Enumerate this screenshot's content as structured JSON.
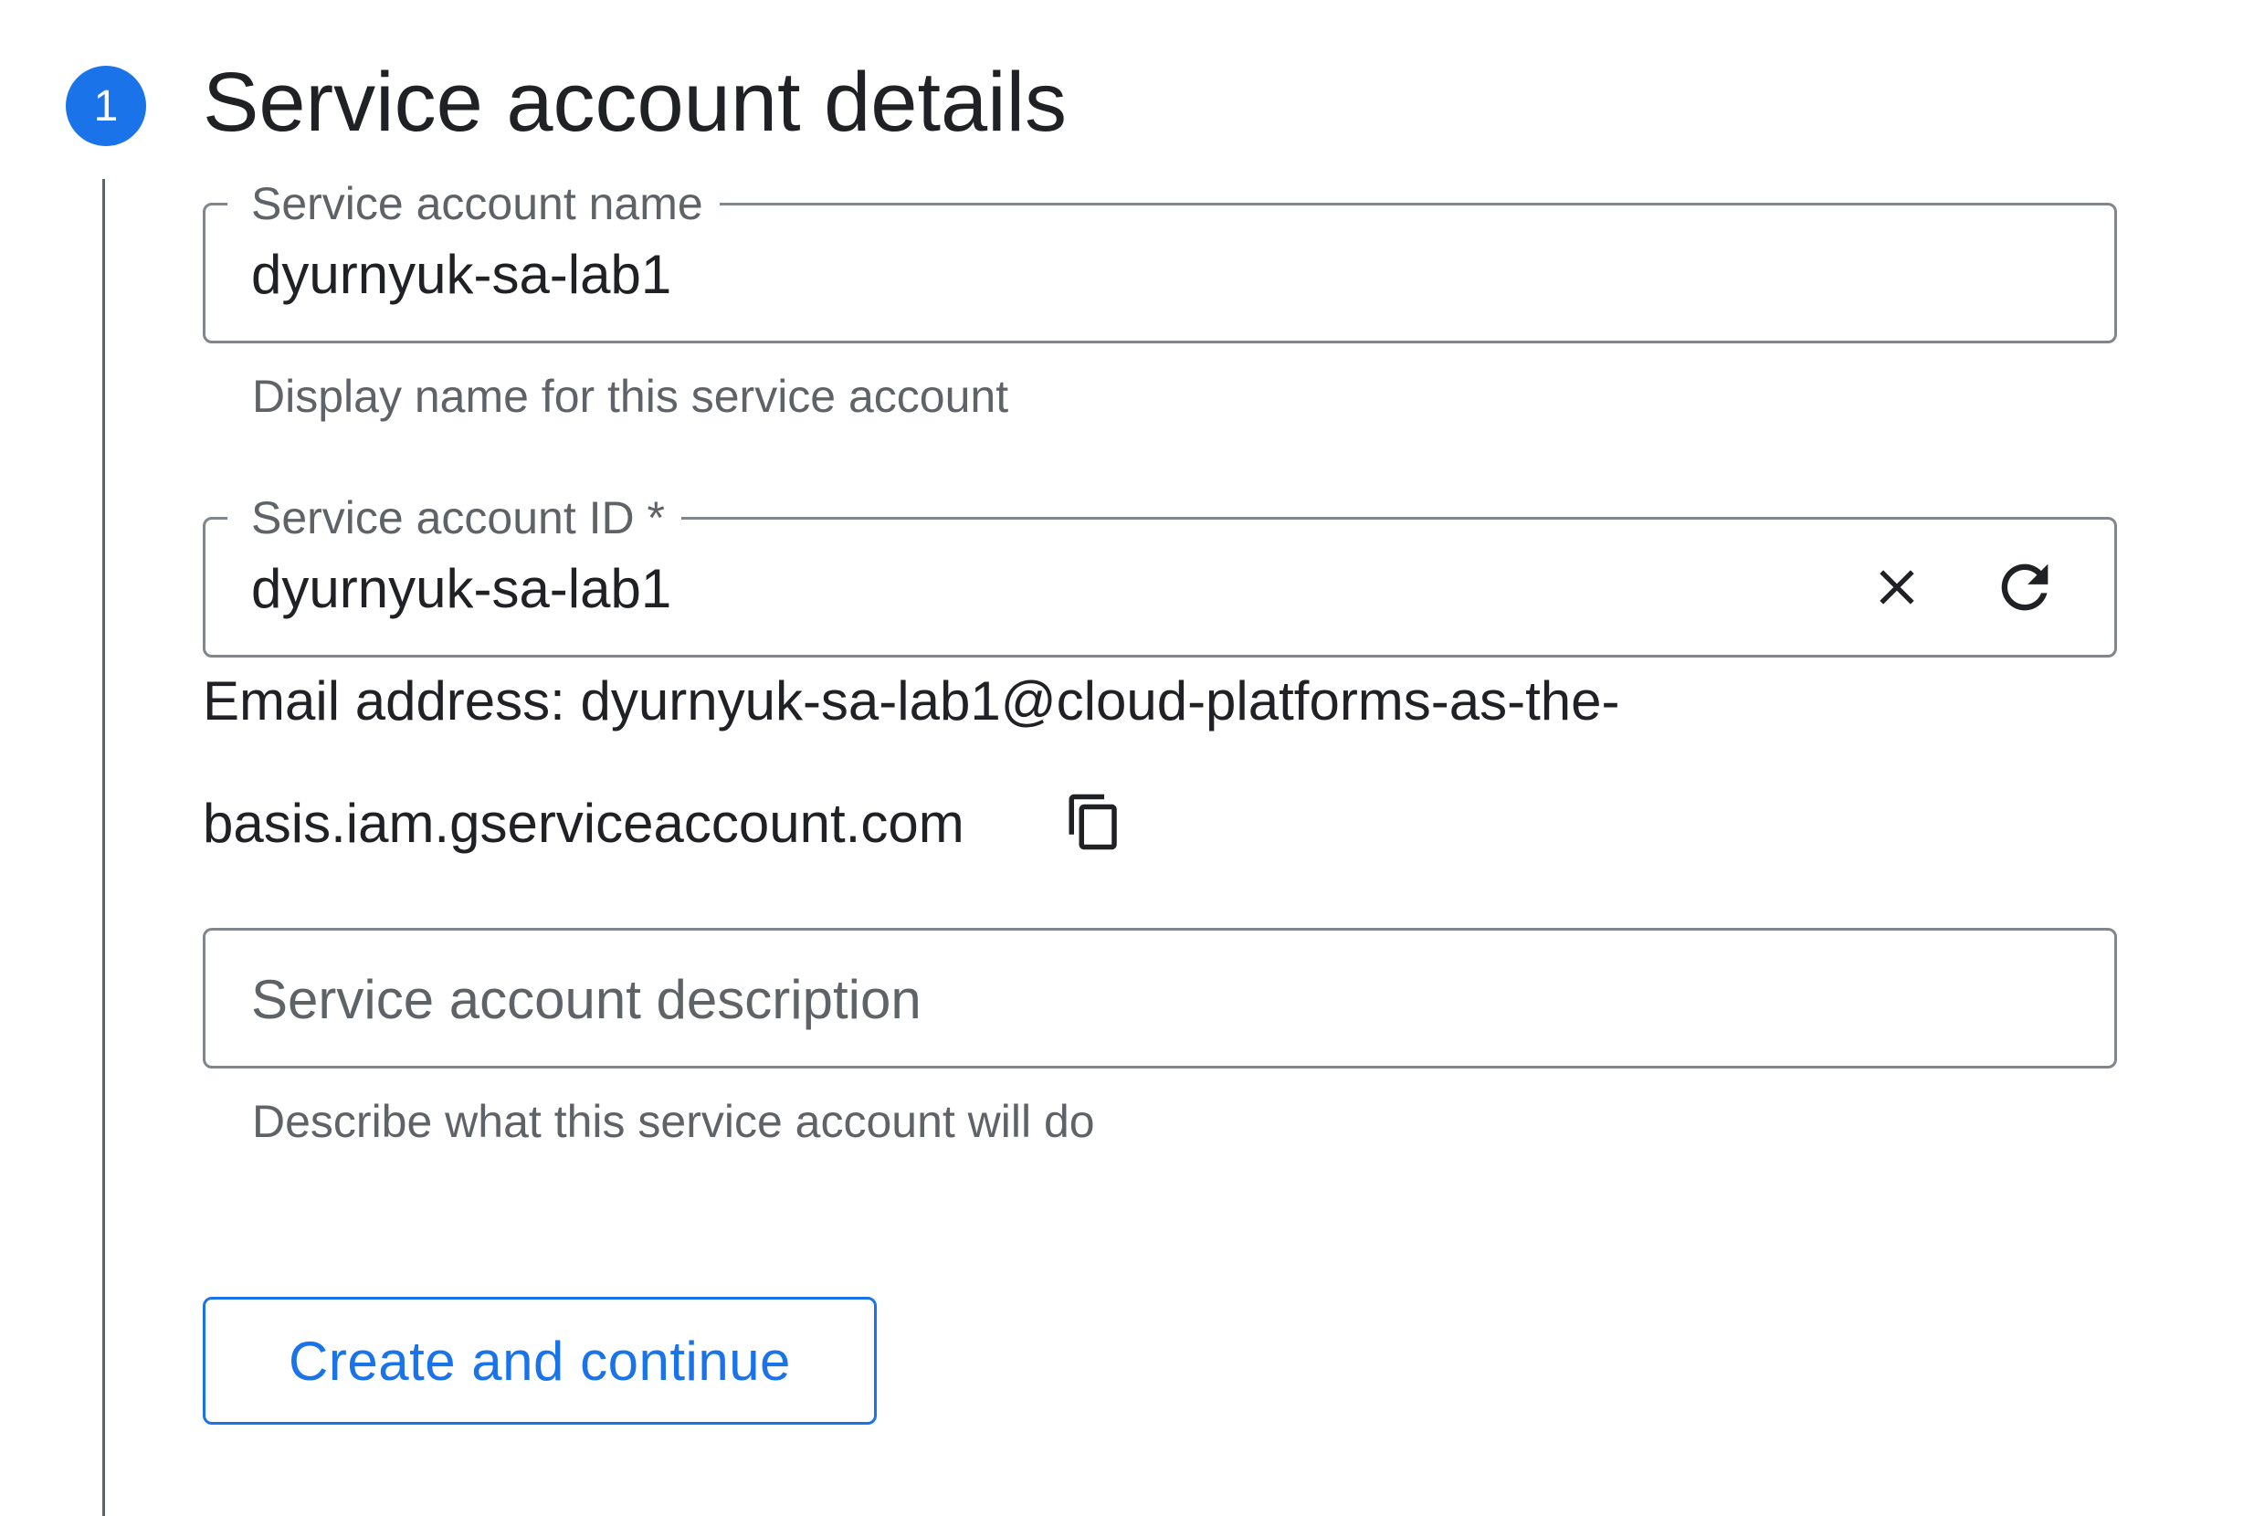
{
  "step": {
    "number": "1",
    "title": "Service account details",
    "accent_color": "#1a73e8"
  },
  "name_field": {
    "label": "Service account name",
    "value": "dyurnyuk-sa-lab1",
    "helper": "Display name for this service account"
  },
  "id_field": {
    "label": "Service account ID *",
    "value": "dyurnyuk-sa-lab1",
    "clear_icon": "close-icon",
    "refresh_icon": "refresh-icon"
  },
  "email": {
    "line1": "Email address: dyurnyuk-sa-lab1@cloud-platforms-as-the-",
    "line2": "basis.iam.gserviceaccount.com",
    "copy_icon": "copy-icon"
  },
  "description_field": {
    "placeholder": "Service account description",
    "value": "",
    "helper": "Describe what this service account will do"
  },
  "actions": {
    "create_label": "Create and continue"
  }
}
